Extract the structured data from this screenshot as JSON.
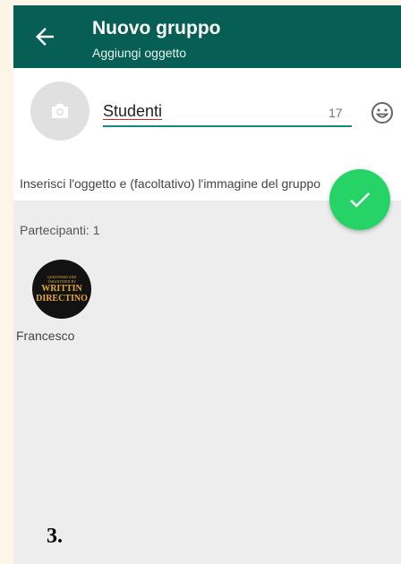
{
  "header": {
    "title": "Nuovo gruppo",
    "subtitle": "Aggiungi oggetto",
    "back_icon": "arrow-left-icon"
  },
  "group": {
    "subject_value": "Studenti",
    "char_counter": "17",
    "hint": "Inserisci l'oggetto e (facoltativo) l'immagine del gruppo",
    "photo_icon": "camera-icon",
    "emoji_icon": "emoji-icon"
  },
  "confirm": {
    "icon": "check-icon",
    "color": "#25d366"
  },
  "participants": {
    "label": "Partecipanti: 1",
    "items": [
      {
        "name": "Francesco",
        "avatar_text_small": "QUENTINED AND TARANTINED BY",
        "avatar_text_big": "WRITTIN DIRECTINO"
      }
    ]
  },
  "annotation": "3.",
  "colors": {
    "appbar": "#075e54",
    "accent": "#128c7e",
    "fab": "#25d366"
  }
}
